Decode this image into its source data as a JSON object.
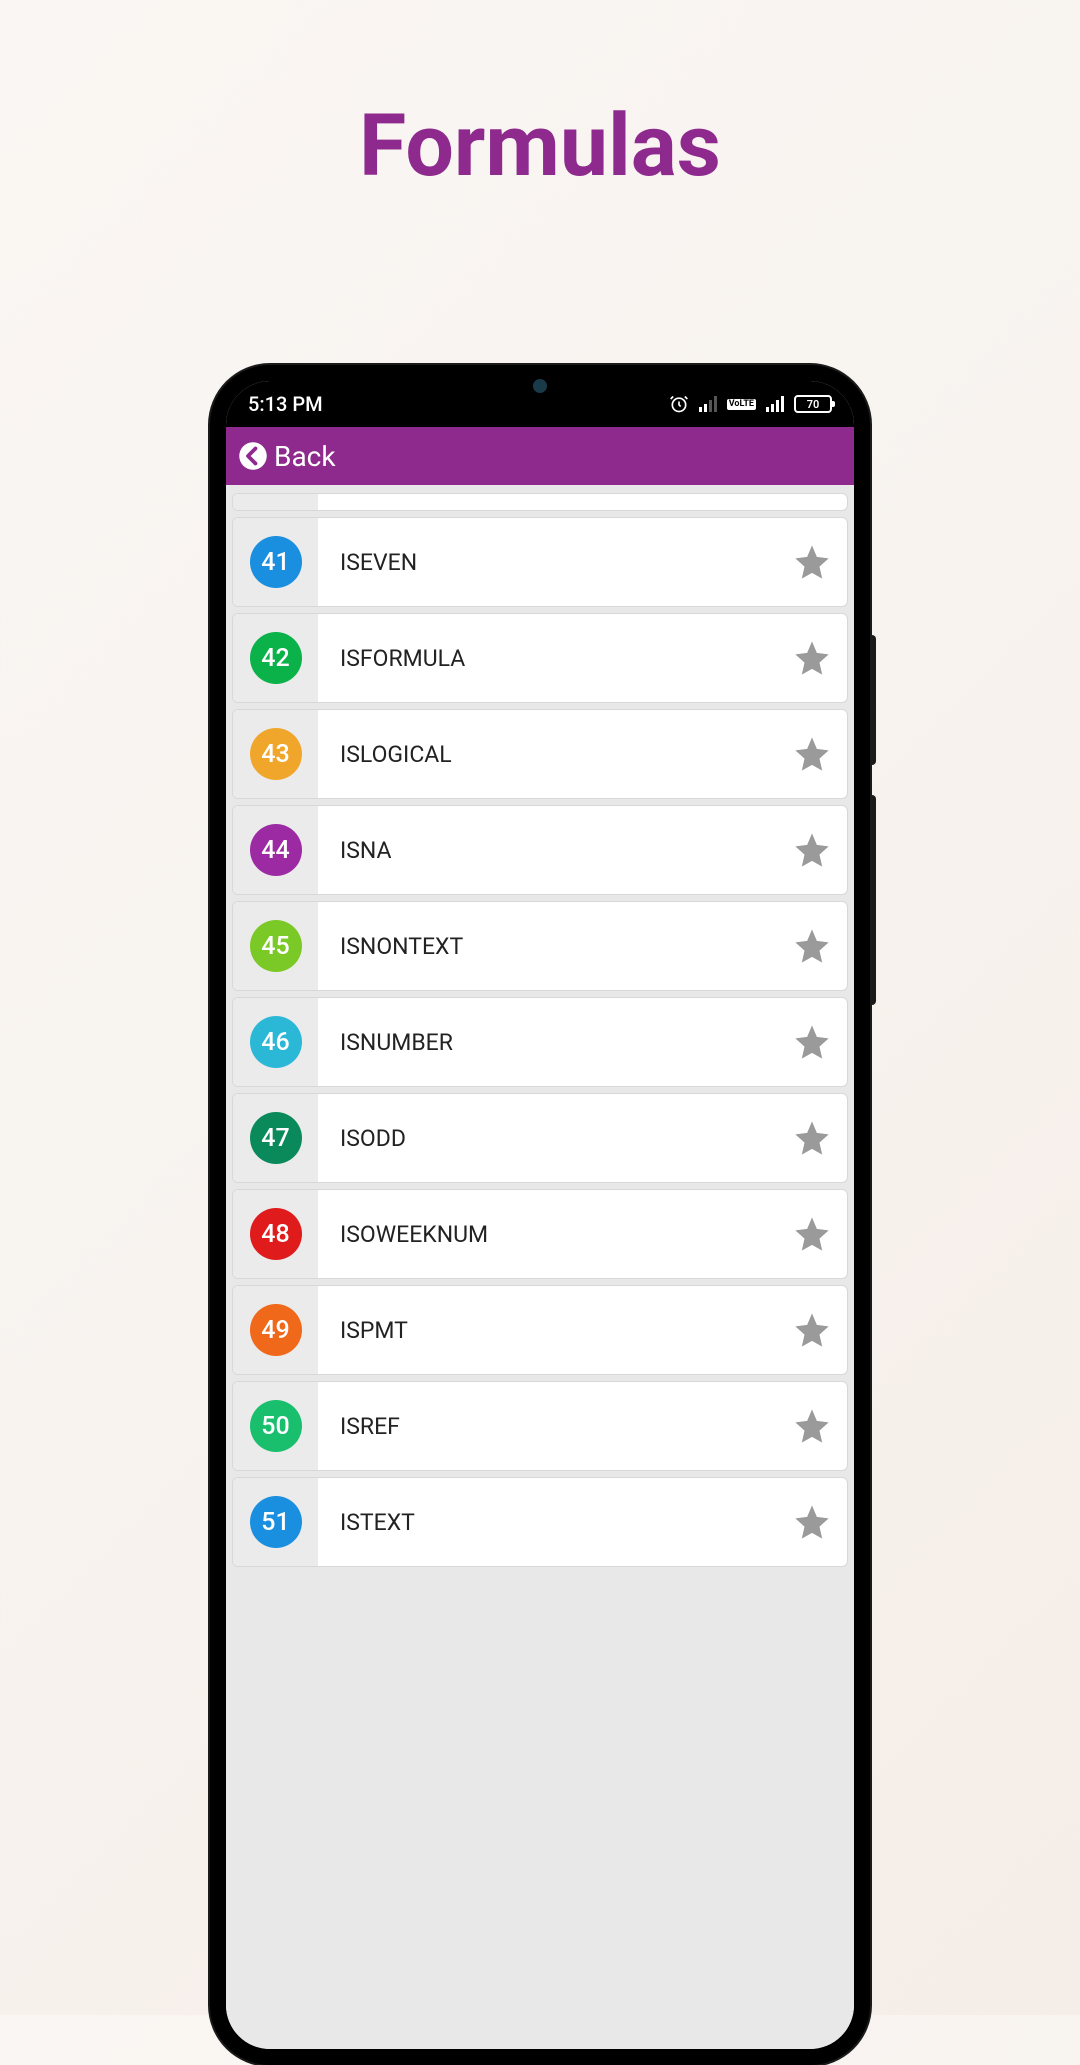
{
  "page": {
    "title": "Formulas"
  },
  "status": {
    "time": "5:13 PM",
    "battery": "70"
  },
  "appbar": {
    "back_label": "Back"
  },
  "items": [
    {
      "num": "41",
      "label": "ISEVEN",
      "color": "#1a8fe0"
    },
    {
      "num": "42",
      "label": "ISFORMULA",
      "color": "#0bb24a"
    },
    {
      "num": "43",
      "label": "ISLOGICAL",
      "color": "#f0a62a"
    },
    {
      "num": "44",
      "label": "ISNA",
      "color": "#9b2aa3"
    },
    {
      "num": "45",
      "label": "ISNONTEXT",
      "color": "#7bc926"
    },
    {
      "num": "46",
      "label": "ISNUMBER",
      "color": "#2ab8d6"
    },
    {
      "num": "47",
      "label": "ISODD",
      "color": "#0a8a5a"
    },
    {
      "num": "48",
      "label": "ISOWEEKNUM",
      "color": "#e01b1b"
    },
    {
      "num": "49",
      "label": "ISPMT",
      "color": "#f0681a"
    },
    {
      "num": "50",
      "label": "ISREF",
      "color": "#1abf6e"
    },
    {
      "num": "51",
      "label": "ISTEXT",
      "color": "#1a8fe0"
    }
  ]
}
